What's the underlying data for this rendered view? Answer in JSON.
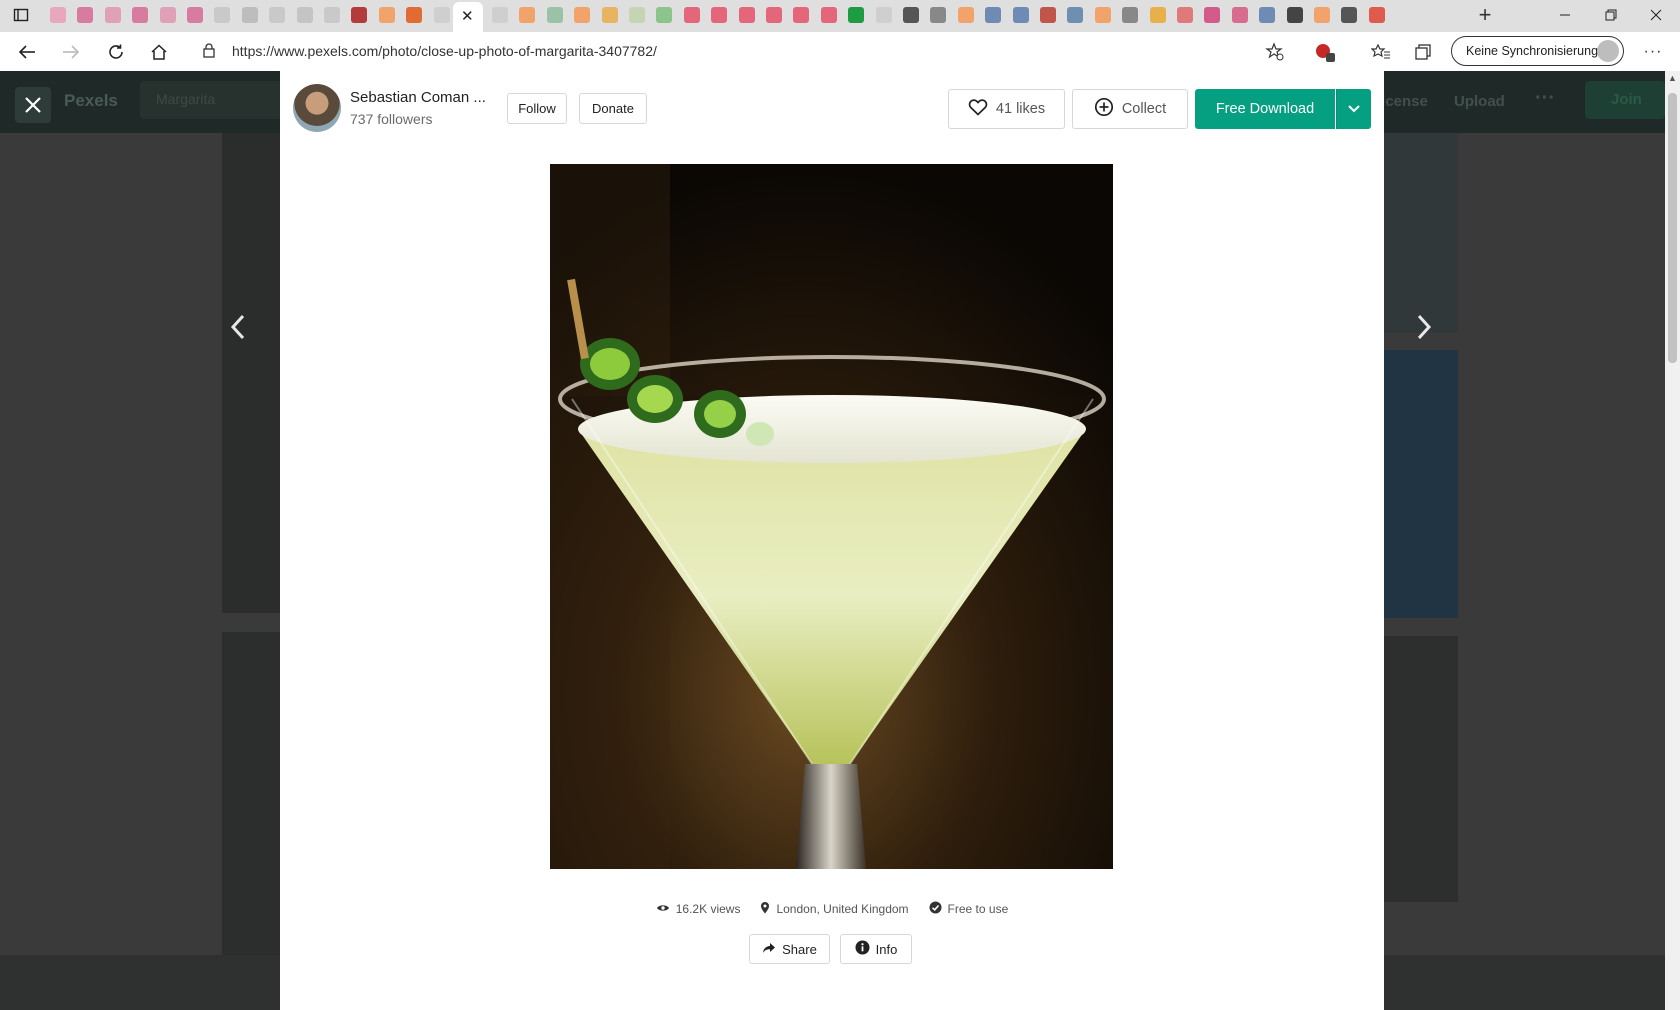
{
  "browser": {
    "url": "https://www.pexels.com/photo/close-up-photo-of-margarita-3407782/",
    "sync_label": "Keine Synchronisierung",
    "tabs": [
      {
        "icon": "pink-tab-icon",
        "color": "#e8a7bd"
      },
      {
        "icon": "pink-tab-icon",
        "color": "#d77ba0"
      },
      {
        "icon": "pink-tab-icon",
        "color": "#e0a0b8"
      },
      {
        "icon": "pink-tab-icon",
        "color": "#d77ba0"
      },
      {
        "icon": "pink-tab-icon",
        "color": "#e0a0b8"
      },
      {
        "icon": "pink-tab-icon",
        "color": "#d77ba0"
      },
      {
        "icon": "page-tab-icon",
        "color": "#c9c9c9"
      },
      {
        "icon": "page-tab-icon",
        "color": "#bdbdbd"
      },
      {
        "icon": "page-tab-icon",
        "color": "#c9c9c9"
      },
      {
        "icon": "page-tab-icon",
        "color": "#c4c4c4"
      },
      {
        "icon": "page-tab-icon",
        "color": "#c9c9c9"
      },
      {
        "icon": "cherry-tab-icon",
        "color": "#b33b3b"
      },
      {
        "icon": "duckduckgo-tab-icon",
        "color": "#f1a36b"
      },
      {
        "icon": "duckduckgo-tab-icon",
        "color": "#e26b33"
      },
      {
        "icon": "page-tab-icon",
        "color": "#cfcfcf"
      },
      {
        "icon": "page-tab-icon",
        "color": "#cfcfcf"
      },
      {
        "icon": "duckduckgo-tab-icon",
        "color": "#f1a36b"
      },
      {
        "icon": "globe-tab-icon",
        "color": "#9ac2a7"
      },
      {
        "icon": "duckduckgo-tab-icon",
        "color": "#f1a36b"
      },
      {
        "icon": "rainbow-tab-icon",
        "color": "#e7b561"
      },
      {
        "icon": "page-tab-icon",
        "color": "#c5d5b3"
      },
      {
        "icon": "chat-tab-icon",
        "color": "#8cc48c"
      },
      {
        "icon": "pinterest-tab-icon",
        "color": "#e3667b"
      },
      {
        "icon": "pinterest-tab-icon",
        "color": "#e3667b"
      },
      {
        "icon": "pinterest-tab-icon",
        "color": "#e3667b"
      },
      {
        "icon": "pinterest-tab-icon",
        "color": "#e3667b"
      },
      {
        "icon": "pinterest-tab-icon",
        "color": "#e3667b"
      },
      {
        "icon": "pinterest-tab-icon",
        "color": "#e3667b"
      },
      {
        "icon": "pexels-tab-icon",
        "color": "#1e9c43"
      },
      {
        "icon": "page-tab-icon",
        "color": "#cfcfcf"
      },
      {
        "icon": "wikipedia-tab-icon",
        "color": "#555555"
      },
      {
        "icon": "wikipedia-tab-icon",
        "color": "#888888"
      },
      {
        "icon": "duckduckgo-tab-icon",
        "color": "#f1a36b"
      },
      {
        "icon": "drop-tab-icon",
        "color": "#6d8bb3"
      },
      {
        "icon": "drop-tab-icon",
        "color": "#6d8bb3"
      },
      {
        "icon": "red-tab-icon",
        "color": "#c1554a"
      },
      {
        "icon": "tools-tab-icon",
        "color": "#6e8fb0"
      },
      {
        "icon": "duckduckgo-tab-icon",
        "color": "#f1a36b"
      },
      {
        "icon": "wikipedia-tab-icon",
        "color": "#888888"
      },
      {
        "icon": "ycombinator-tab-icon",
        "color": "#e8b04a"
      },
      {
        "icon": "red-tab-icon",
        "color": "#e07a7a"
      },
      {
        "icon": "flickr-tab-icon",
        "color": "#d25b8c"
      },
      {
        "icon": "swirl-tab-icon",
        "color": "#d86c8e"
      },
      {
        "icon": "drop-tab-icon",
        "color": "#6d8bb3"
      },
      {
        "icon": "d-tab-icon",
        "color": "#444444"
      },
      {
        "icon": "duckduckgo-tab-icon",
        "color": "#f1a36b"
      },
      {
        "icon": "bug-tab-icon",
        "color": "#555555"
      },
      {
        "icon": "adobe-tab-icon",
        "color": "#e15a4e"
      }
    ]
  },
  "site": {
    "brand": "Pexels",
    "search_value": "Margarita",
    "nav": [
      "License",
      "Upload"
    ],
    "more": "···",
    "join": "Join"
  },
  "modal": {
    "author": {
      "name": "Sebastian Coman ...",
      "followers": "737 followers"
    },
    "follow_label": "Follow",
    "donate_label": "Donate",
    "likes_label": "41 likes",
    "collect_label": "Collect",
    "download_label": "Free Download",
    "meta": {
      "views": "16.2K views",
      "location": "London, United Kingdom",
      "license": "Free to use"
    },
    "share_label": "Share",
    "info_label": "Info"
  }
}
